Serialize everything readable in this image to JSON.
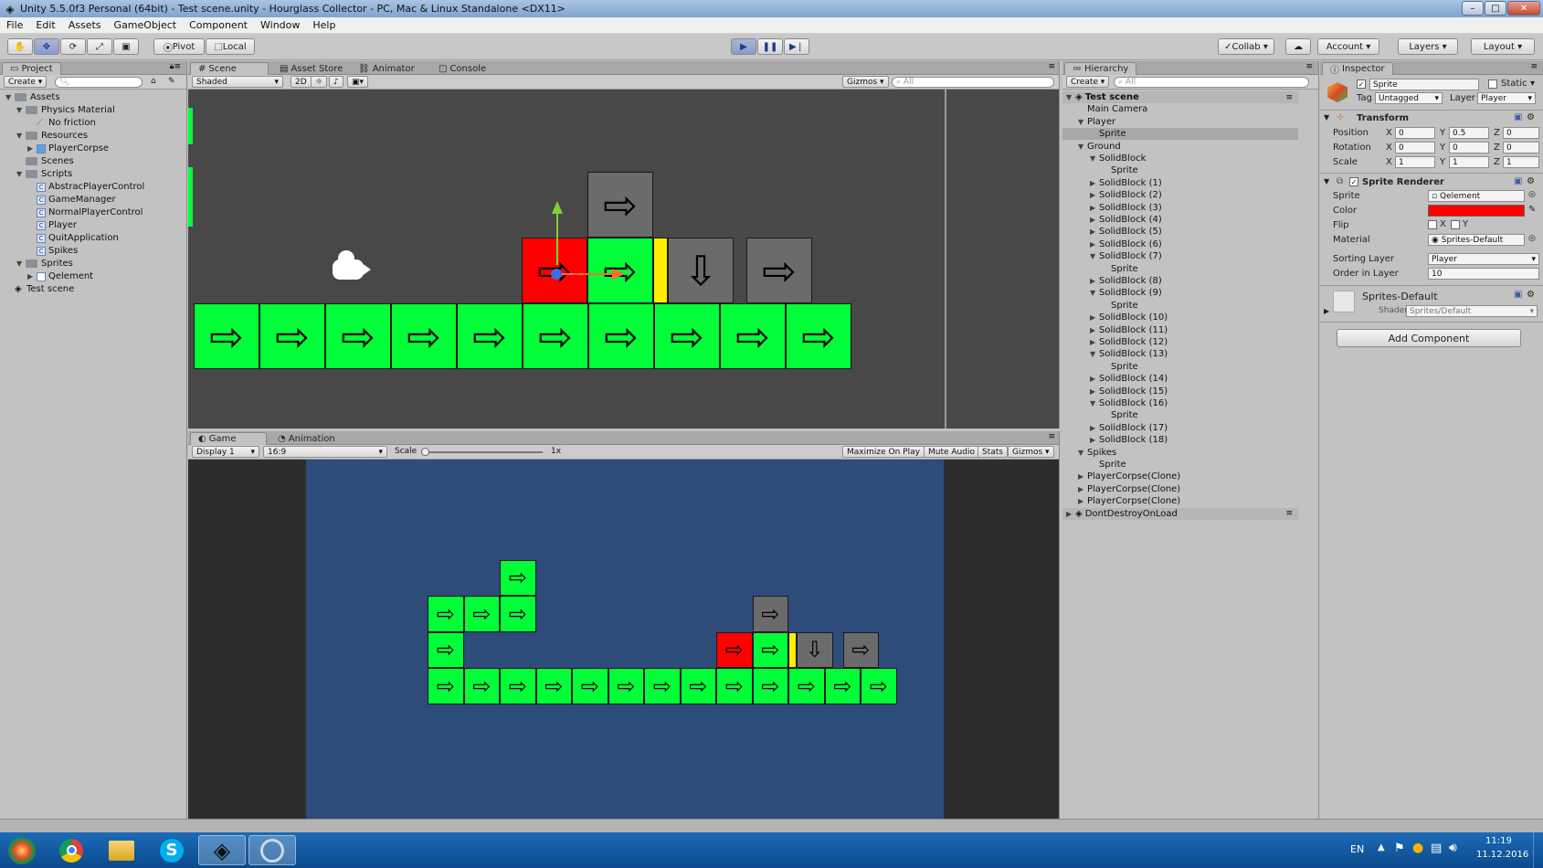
{
  "window": {
    "title": "Unity 5.5.0f3 Personal (64bit) - Test scene.unity - Hourglass Collector - PC, Mac & Linux Standalone <DX11>"
  },
  "menu": [
    "File",
    "Edit",
    "Assets",
    "GameObject",
    "Component",
    "Window",
    "Help"
  ],
  "toolbar": {
    "pivot": "Pivot",
    "local": "Local",
    "collab": "Collab",
    "account": "Account",
    "layers": "Layers",
    "layout": "Layout",
    "play_state": "playing"
  },
  "project": {
    "tab": "Project",
    "create": "Create",
    "items": [
      {
        "label": "Assets",
        "depth": 0,
        "tri": "▼",
        "kind": "folder"
      },
      {
        "label": "Physics Material",
        "depth": 1,
        "tri": "▼",
        "kind": "folder"
      },
      {
        "label": "No friction",
        "depth": 2,
        "tri": "",
        "kind": "material"
      },
      {
        "label": "Resources",
        "depth": 1,
        "tri": "▼",
        "kind": "folder"
      },
      {
        "label": "PlayerCorpse",
        "depth": 2,
        "tri": "▶",
        "kind": "prefab"
      },
      {
        "label": "Scenes",
        "depth": 1,
        "tri": "",
        "kind": "folder"
      },
      {
        "label": "Scripts",
        "depth": 1,
        "tri": "▼",
        "kind": "folder"
      },
      {
        "label": "AbstracPlayerControl",
        "depth": 2,
        "tri": "",
        "kind": "script"
      },
      {
        "label": "GameManager",
        "depth": 2,
        "tri": "",
        "kind": "script"
      },
      {
        "label": "NormalPlayerControl",
        "depth": 2,
        "tri": "",
        "kind": "script"
      },
      {
        "label": "Player",
        "depth": 2,
        "tri": "",
        "kind": "script"
      },
      {
        "label": "QuitApplication",
        "depth": 2,
        "tri": "",
        "kind": "script"
      },
      {
        "label": "Spikes",
        "depth": 2,
        "tri": "",
        "kind": "script"
      },
      {
        "label": "Sprites",
        "depth": 1,
        "tri": "▼",
        "kind": "folder"
      },
      {
        "label": "Qelement",
        "depth": 2,
        "tri": "▶",
        "kind": "sprite"
      },
      {
        "label": "Test scene",
        "depth": 0,
        "tri": "",
        "kind": "scene"
      }
    ]
  },
  "scene": {
    "tabs": [
      "Scene",
      "Asset Store",
      "Animator",
      "Console"
    ],
    "shading": "Shaded",
    "mode2d": "2D",
    "gizmos": "Gizmos",
    "search": "All"
  },
  "game": {
    "tabs": [
      "Game",
      "Animation"
    ],
    "display": "Display 1",
    "aspect": "16:9",
    "scale_label": "Scale",
    "scale_value": "1x",
    "maximize": "Maximize On Play",
    "mute": "Mute Audio",
    "stats": "Stats",
    "gizmos": "Gizmos"
  },
  "hierarchy": {
    "tab": "Hierarchy",
    "create": "Create",
    "search": "All",
    "items": [
      {
        "label": "Test scene",
        "depth": 0,
        "tri": "▼",
        "bold": true,
        "scene": true
      },
      {
        "label": "Main Camera",
        "depth": 1,
        "tri": ""
      },
      {
        "label": "Player",
        "depth": 1,
        "tri": "▼"
      },
      {
        "label": "Sprite",
        "depth": 2,
        "tri": "",
        "selected": true
      },
      {
        "label": "Ground",
        "depth": 1,
        "tri": "▼"
      },
      {
        "label": "SolidBlock",
        "depth": 2,
        "tri": "▼"
      },
      {
        "label": "Sprite",
        "depth": 3,
        "tri": ""
      },
      {
        "label": "SolidBlock (1)",
        "depth": 2,
        "tri": "▶"
      },
      {
        "label": "SolidBlock (2)",
        "depth": 2,
        "tri": "▶"
      },
      {
        "label": "SolidBlock (3)",
        "depth": 2,
        "tri": "▶"
      },
      {
        "label": "SolidBlock (4)",
        "depth": 2,
        "tri": "▶"
      },
      {
        "label": "SolidBlock (5)",
        "depth": 2,
        "tri": "▶"
      },
      {
        "label": "SolidBlock (6)",
        "depth": 2,
        "tri": "▶"
      },
      {
        "label": "SolidBlock (7)",
        "depth": 2,
        "tri": "▼"
      },
      {
        "label": "Sprite",
        "depth": 3,
        "tri": ""
      },
      {
        "label": "SolidBlock (8)",
        "depth": 2,
        "tri": "▶"
      },
      {
        "label": "SolidBlock (9)",
        "depth": 2,
        "tri": "▼"
      },
      {
        "label": "Sprite",
        "depth": 3,
        "tri": ""
      },
      {
        "label": "SolidBlock (10)",
        "depth": 2,
        "tri": "▶"
      },
      {
        "label": "SolidBlock (11)",
        "depth": 2,
        "tri": "▶"
      },
      {
        "label": "SolidBlock (12)",
        "depth": 2,
        "tri": "▶"
      },
      {
        "label": "SolidBlock (13)",
        "depth": 2,
        "tri": "▼"
      },
      {
        "label": "Sprite",
        "depth": 3,
        "tri": ""
      },
      {
        "label": "SolidBlock (14)",
        "depth": 2,
        "tri": "▶"
      },
      {
        "label": "SolidBlock (15)",
        "depth": 2,
        "tri": "▶"
      },
      {
        "label": "SolidBlock (16)",
        "depth": 2,
        "tri": "▼"
      },
      {
        "label": "Sprite",
        "depth": 3,
        "tri": ""
      },
      {
        "label": "SolidBlock (17)",
        "depth": 2,
        "tri": "▶"
      },
      {
        "label": "SolidBlock (18)",
        "depth": 2,
        "tri": "▶"
      },
      {
        "label": "Spikes",
        "depth": 1,
        "tri": "▼"
      },
      {
        "label": "Sprite",
        "depth": 2,
        "tri": ""
      },
      {
        "label": "PlayerCorpse(Clone)",
        "depth": 1,
        "tri": "▶"
      },
      {
        "label": "PlayerCorpse(Clone)",
        "depth": 1,
        "tri": "▶"
      },
      {
        "label": "PlayerCorpse(Clone)",
        "depth": 1,
        "tri": "▶"
      },
      {
        "label": "DontDestroyOnLoad",
        "depth": 0,
        "tri": "▶",
        "scene": true
      }
    ]
  },
  "inspector": {
    "tab": "Inspector",
    "name": "Sprite",
    "static": "Static",
    "tag_label": "Tag",
    "tag": "Untagged",
    "layer_label": "Layer",
    "layer": "Player",
    "transform": {
      "title": "Transform",
      "position_label": "Position",
      "position": [
        "0",
        "0.5",
        "0"
      ],
      "rotation_label": "Rotation",
      "rotation": [
        "0",
        "0",
        "0"
      ],
      "scale_label": "Scale",
      "scale": [
        "1",
        "1",
        "1"
      ]
    },
    "sprite_renderer": {
      "title": "Sprite Renderer",
      "sprite_label": "Sprite",
      "sprite": "Qelement",
      "color_label": "Color",
      "color": "#ff0000",
      "flip_label": "Flip",
      "flip_x": "X",
      "flip_y": "Y",
      "material_label": "Material",
      "material": "Sprites-Default",
      "sorting_label": "Sorting Layer",
      "sorting": "Player",
      "order_label": "Order in Layer",
      "order": "10"
    },
    "material": {
      "name": "Sprites-Default",
      "shader_label": "Shader",
      "shader": "Sprites/Default"
    },
    "add_component": "Add Component"
  },
  "taskbar": {
    "lang": "EN",
    "time": "11:19",
    "date": "11.12.2016"
  },
  "colors": {
    "accent": "#3b6fd1",
    "block_green": "#00ff38",
    "block_gray": "#6b6b6b",
    "player_red": "#ff0000",
    "hourglass_yellow": "#ffee00",
    "game_bg": "#2e4c7a",
    "scene_bg": "#484848"
  }
}
